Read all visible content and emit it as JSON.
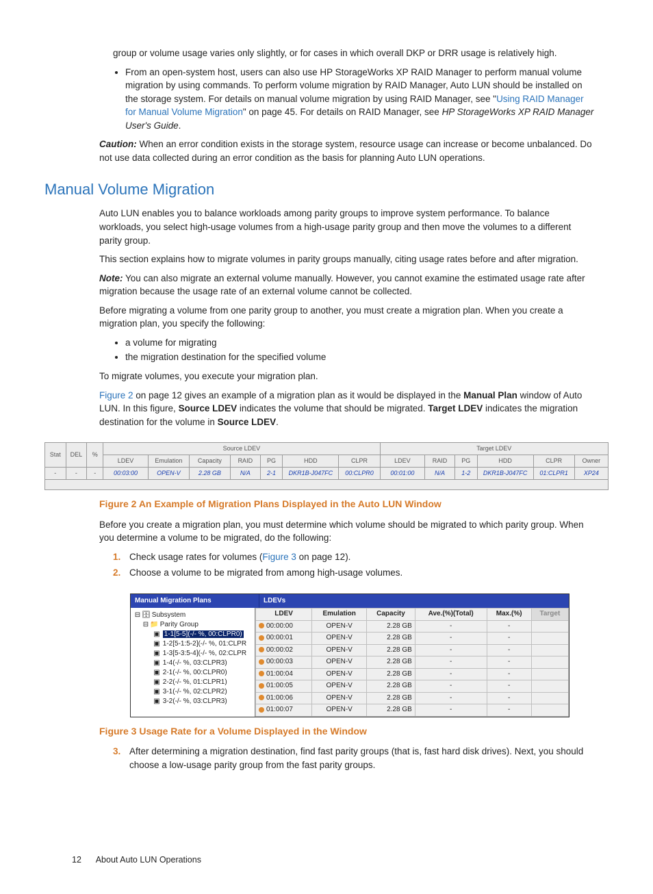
{
  "intro": {
    "cont_para": "group or volume usage varies only slightly, or for cases in which overall DKP or DRR usage is relatively high.",
    "bullet_para_1": "From an open-system host, users can also use HP StorageWorks XP RAID Manager to perform manual volume migration by using commands. To perform volume migration by RAID Manager, Auto LUN should be installed on the storage system. For details on manual volume migration by using RAID Manager, see \"",
    "bullet_link": "Using RAID Manager for Manual Volume Migration",
    "bullet_para_2": "\" on page 45. For details on RAID Manager, see ",
    "bullet_italic": "HP StorageWorks XP RAID Manager User's Guide",
    "bullet_para_3": "."
  },
  "caution": {
    "label": "Caution:",
    "text": " When an error condition exists in the storage system, resource usage can increase or become unbalanced. Do not use data collected during an error condition as the basis for planning Auto LUN operations."
  },
  "section_title": "Manual Volume Migration",
  "mvm": {
    "p1": "Auto LUN enables you to balance workloads among parity groups to improve system performance. To balance workloads, you select high-usage volumes from a high-usage parity group and then move the volumes to a different parity group.",
    "p2": "This section explains how to migrate volumes in parity groups manually, citing usage rates before and after migration.",
    "note_label": "Note:",
    "note_text": " You can also migrate an external volume manually. However, you cannot examine the estimated usage rate after migration because the usage rate of an external volume cannot be collected.",
    "p3": "Before migrating a volume from one parity group to another, you must create a migration plan. When you create a migration plan, you specify the following:",
    "b1": "a volume for migrating",
    "b2": "the migration destination for the specified volume",
    "p4": "To migrate volumes, you execute your migration plan.",
    "p5a": "Figure 2",
    "p5b": " on page 12 gives an example of a migration plan as it would be displayed in the ",
    "p5c": "Manual Plan",
    "p5d": " window of Auto LUN. In this figure, ",
    "p5e": "Source LDEV",
    "p5f": " indicates the volume that should be migrated. ",
    "p5g": "Target LDEV",
    "p5h": " indicates the migration destination for the volume in ",
    "p5i": "Source LDEV",
    "p5j": "."
  },
  "fig2": {
    "hdr": {
      "stat": "Stat",
      "del": "DEL",
      "pct": "%",
      "src": "Source LDEV",
      "tgt": "Target LDEV",
      "ldev": "LDEV",
      "emu": "Emulation",
      "cap": "Capacity",
      "raid": "RAID",
      "pg": "PG",
      "hdd": "HDD",
      "clpr": "CLPR",
      "owner": "Owner"
    },
    "row": {
      "stat": "-",
      "del": "-",
      "pct": "-",
      "s_ldev": "00:03:00",
      "s_emu": "OPEN-V",
      "s_cap": "2.28 GB",
      "s_raid": "N/A",
      "s_pg": "2-1",
      "s_hdd": "DKR1B-J047FC",
      "s_clpr": "00:CLPR0",
      "t_ldev": "00:01:00",
      "t_raid": "N/A",
      "t_pg": "1-2",
      "t_hdd": "DKR1B-J047FC",
      "t_clpr": "01:CLPR1",
      "t_owner": "XP24"
    },
    "caption": "Figure 2 An Example of Migration Plans Displayed in the Auto LUN Window"
  },
  "after_fig2": {
    "p1": "Before you create a migration plan, you must determine which volume should be migrated to which parity group. When you determine a volume to be migrated, do the following:",
    "s1a": "Check usage rates for volumes (",
    "s1b": "Figure 3",
    "s1c": " on page 12).",
    "s2": "Choose a volume to be migrated from among high-usage volumes."
  },
  "fig3": {
    "title_left": "Manual Migration Plans",
    "title_right": "LDEVs",
    "tree": {
      "root": "Subsystem",
      "pg_label": "Parity Group",
      "items": [
        {
          "label": "1-1[5-5](-/- %, 00:CLPR0)",
          "sel": true
        },
        {
          "label": "1-2[5-1:5-2](-/- %, 01:CLPR"
        },
        {
          "label": "1-3[5-3:5-4](-/- %, 02:CLPR"
        },
        {
          "label": "1-4(-/- %, 03:CLPR3)"
        },
        {
          "label": "2-1(-/- %, 00:CLPR0)"
        },
        {
          "label": "2-2(-/- %, 01:CLPR1)"
        },
        {
          "label": "3-1(-/- %, 02:CLPR2)"
        },
        {
          "label": "3-2(-/- %, 03:CLPR3)"
        }
      ]
    },
    "cols": {
      "ldev": "LDEV",
      "emu": "Emulation",
      "cap": "Capacity",
      "ave": "Ave.(%)(Total)",
      "max": "Max.(%)",
      "target": "Target"
    },
    "rows": [
      {
        "ldev": "00:00:00",
        "emu": "OPEN-V",
        "cap": "2.28 GB",
        "ave": "-",
        "max": "-"
      },
      {
        "ldev": "00:00:01",
        "emu": "OPEN-V",
        "cap": "2.28 GB",
        "ave": "-",
        "max": "-"
      },
      {
        "ldev": "00:00:02",
        "emu": "OPEN-V",
        "cap": "2.28 GB",
        "ave": "-",
        "max": "-"
      },
      {
        "ldev": "00:00:03",
        "emu": "OPEN-V",
        "cap": "2.28 GB",
        "ave": "-",
        "max": "-"
      },
      {
        "ldev": "01:00:04",
        "emu": "OPEN-V",
        "cap": "2.28 GB",
        "ave": "-",
        "max": "-"
      },
      {
        "ldev": "01:00:05",
        "emu": "OPEN-V",
        "cap": "2.28 GB",
        "ave": "-",
        "max": "-"
      },
      {
        "ldev": "01:00:06",
        "emu": "OPEN-V",
        "cap": "2.28 GB",
        "ave": "-",
        "max": "-"
      },
      {
        "ldev": "01:00:07",
        "emu": "OPEN-V",
        "cap": "2.28 GB",
        "ave": "-",
        "max": "-"
      }
    ],
    "caption": "Figure 3 Usage Rate for a Volume Displayed in the Window"
  },
  "step3": "After determining a migration destination, find fast parity groups (that is, fast hard disk drives). Next, you should choose a low-usage parity group from the fast parity groups.",
  "footer": {
    "page": "12",
    "title": "About Auto LUN Operations"
  }
}
